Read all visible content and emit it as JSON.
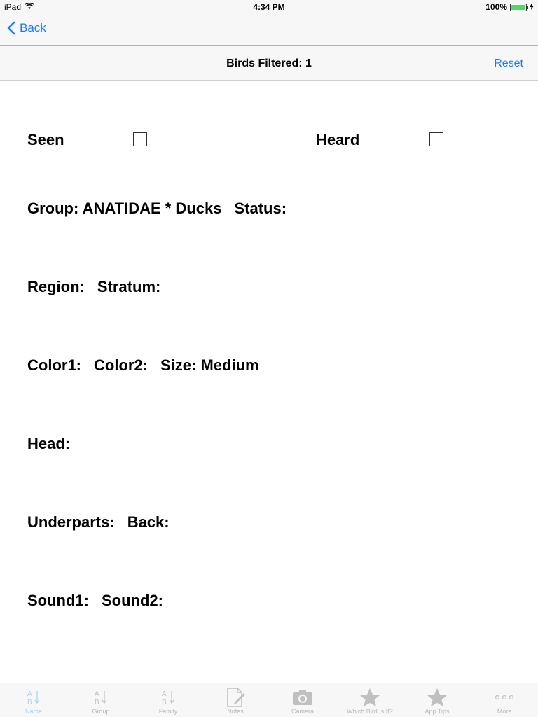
{
  "status": {
    "device": "iPad",
    "time": "4:34 PM",
    "battery": "100%"
  },
  "nav": {
    "back_label": "Back"
  },
  "toolbar": {
    "title": "Birds Filtered: 1",
    "reset_label": "Reset"
  },
  "filters": {
    "seen_label": "Seen",
    "heard_label": "Heard",
    "group": "Group: ANATIDAE * Ducks",
    "status": "Status:",
    "region": "Region:",
    "stratum": "Stratum:",
    "color1": "Color1:",
    "color2": "Color2:",
    "size": "Size: Medium",
    "head": "Head:",
    "underparts": "Underparts:",
    "back": "Back:",
    "sound1": "Sound1:",
    "sound2": "Sound2:"
  },
  "tabs": [
    {
      "label": "Name",
      "icon": "az-sort-icon",
      "active": true
    },
    {
      "label": "Group",
      "icon": "az-sort-icon"
    },
    {
      "label": "Family",
      "icon": "az-sort-icon"
    },
    {
      "label": "Notes",
      "icon": "notes-icon"
    },
    {
      "label": "Camera",
      "icon": "camera-icon"
    },
    {
      "label": "Which Bird Is It?",
      "icon": "star-icon"
    },
    {
      "label": "App Tips",
      "icon": "star-icon"
    },
    {
      "label": "More",
      "icon": "more-icon"
    }
  ]
}
